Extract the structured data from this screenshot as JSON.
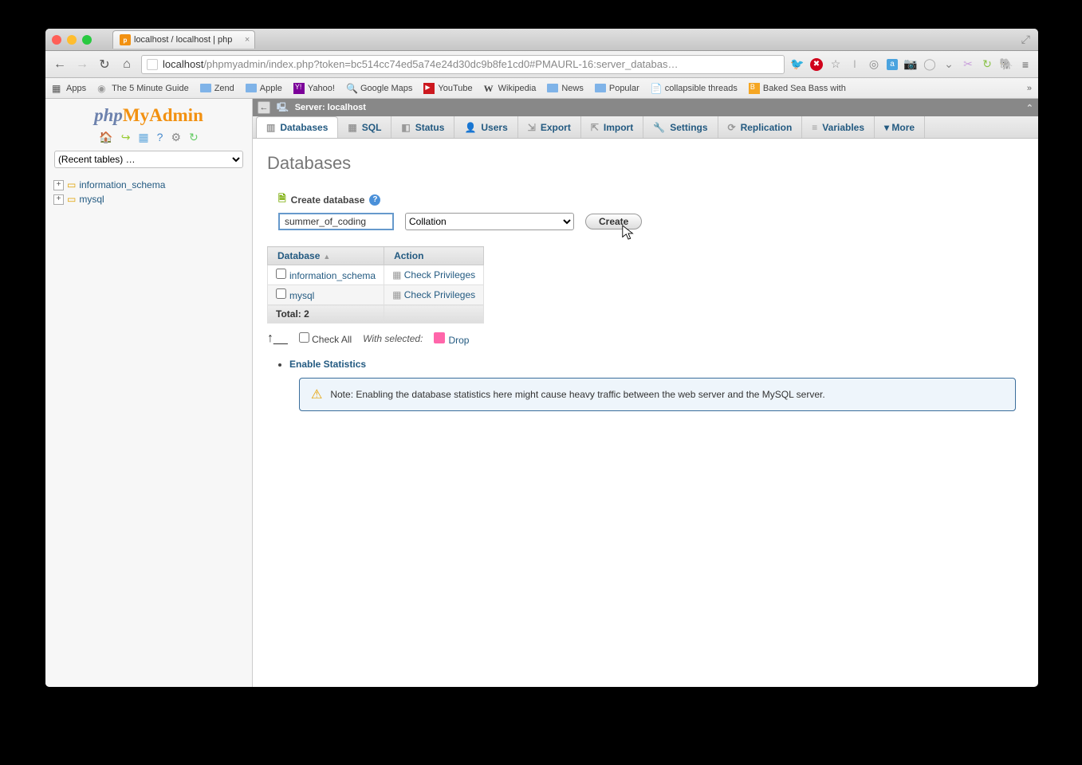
{
  "browser": {
    "tab_title": "localhost / localhost | php",
    "url_host": "localhost",
    "url_path": "/phpmyadmin/index.php?token=bc514cc74ed5a74e24d30dc9b8fe1cd0#PMAURL-16:server_databas…",
    "bookmarks": [
      {
        "label": "Apps",
        "icon": "grid"
      },
      {
        "label": "The 5 Minute Guide",
        "icon": "doc"
      },
      {
        "label": "Zend",
        "icon": "folder"
      },
      {
        "label": "Apple",
        "icon": "folder"
      },
      {
        "label": "Yahoo!",
        "icon": "y"
      },
      {
        "label": "Google Maps",
        "icon": "g"
      },
      {
        "label": "YouTube",
        "icon": "yt"
      },
      {
        "label": "Wikipedia",
        "icon": "w"
      },
      {
        "label": "News",
        "icon": "folder"
      },
      {
        "label": "Popular",
        "icon": "folder"
      },
      {
        "label": "collapsible threads",
        "icon": "doc"
      },
      {
        "label": "Baked Sea Bass with",
        "icon": "b"
      }
    ]
  },
  "sidebar": {
    "recent_placeholder": "(Recent tables) …",
    "tree": [
      {
        "label": "information_schema"
      },
      {
        "label": "mysql"
      }
    ]
  },
  "breadcrumb": {
    "server_label": "Server: localhost"
  },
  "tabs": [
    {
      "label": "Databases",
      "active": true
    },
    {
      "label": "SQL"
    },
    {
      "label": "Status"
    },
    {
      "label": "Users"
    },
    {
      "label": "Export"
    },
    {
      "label": "Import"
    },
    {
      "label": "Settings"
    },
    {
      "label": "Replication"
    },
    {
      "label": "Variables"
    },
    {
      "label": "▾  More"
    }
  ],
  "page": {
    "heading": "Databases",
    "create_label": "Create database",
    "dbname_value": "summer_of_coding",
    "collation_label": "Collation",
    "create_button": "Create",
    "columns": {
      "db": "Database",
      "action": "Action"
    },
    "rows": [
      {
        "name": "information_schema",
        "action": "Check Privileges"
      },
      {
        "name": "mysql",
        "action": "Check Privileges"
      }
    ],
    "total_label": "Total: 2",
    "check_all": "Check All",
    "with_selected": "With selected:",
    "drop": "Drop",
    "enable_stats": "Enable Statistics",
    "notice": "Note: Enabling the database statistics here might cause heavy traffic between the web server and the MySQL server."
  }
}
